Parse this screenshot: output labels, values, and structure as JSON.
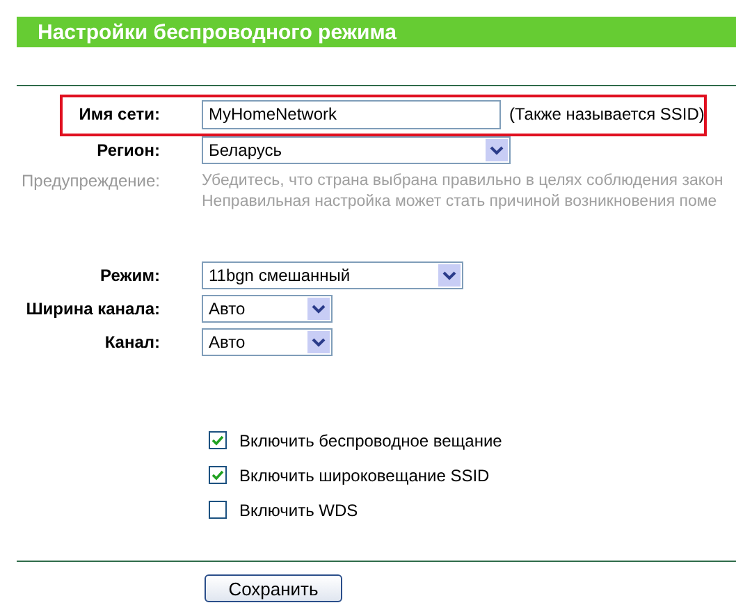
{
  "header": {
    "title": "Настройки беспроводного режима"
  },
  "network_name": {
    "label": "Имя сети:",
    "value": "MyHomeNetwork",
    "note": "(Также называется SSID)",
    "highlighted": true
  },
  "region": {
    "label": "Регион:",
    "value": "Беларусь"
  },
  "warning": {
    "label": "Предупреждение:",
    "lines": [
      "Убедитесь, что страна выбрана правильно в целях соблюдения закон",
      "Неправильная настройка может стать причиной возникновения поме"
    ]
  },
  "selects": [
    {
      "label": "Режим:",
      "value": "11bgn смешанный",
      "kind": "wide"
    },
    {
      "label": "Ширина канала:",
      "value": "Авто",
      "kind": "narrow"
    },
    {
      "label": "Канал:",
      "value": "Авто",
      "kind": "narrow"
    }
  ],
  "options": [
    {
      "label": "Включить беспроводное вещание",
      "checked": true
    },
    {
      "label": "Включить широковещание SSID",
      "checked": true
    },
    {
      "label": "Включить WDS",
      "checked": false
    }
  ],
  "save_button": "Сохранить"
}
